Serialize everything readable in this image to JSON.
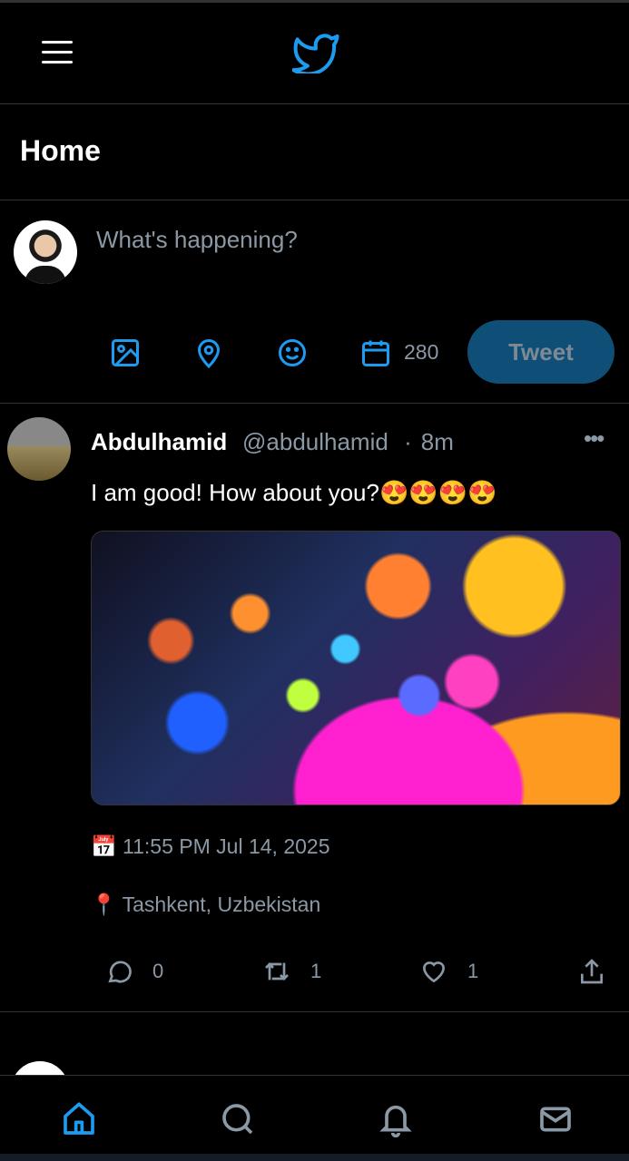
{
  "topbar": {
    "menu_icon": "hamburger-menu-icon",
    "logo": "twitter-bird-logo",
    "brand_color": "#1d9bf0"
  },
  "header": {
    "title": "Home"
  },
  "compose": {
    "placeholder": "What's happening?",
    "char_count": "280",
    "tweet_label": "Tweet",
    "tools": [
      "image-icon",
      "location-pin-icon",
      "emoji-icon",
      "calendar-icon"
    ]
  },
  "tweet": {
    "name": "Abdulhamid",
    "handle": "@abdulhamid",
    "separator": "·",
    "time": "8m",
    "text": "I am good! How about you?😍😍😍😍",
    "date_emoji": "📅",
    "date": "11:55 PM Jul 14, 2025",
    "location_emoji": "📍",
    "location": "Tashkent, Uzbekistan",
    "replies": "0",
    "retweets": "1",
    "likes": "1"
  },
  "nav": {
    "items": [
      "home",
      "search",
      "notifications",
      "messages"
    ],
    "active": "home",
    "active_color": "#1d9bf0",
    "inactive_color": "#8b98a5"
  }
}
